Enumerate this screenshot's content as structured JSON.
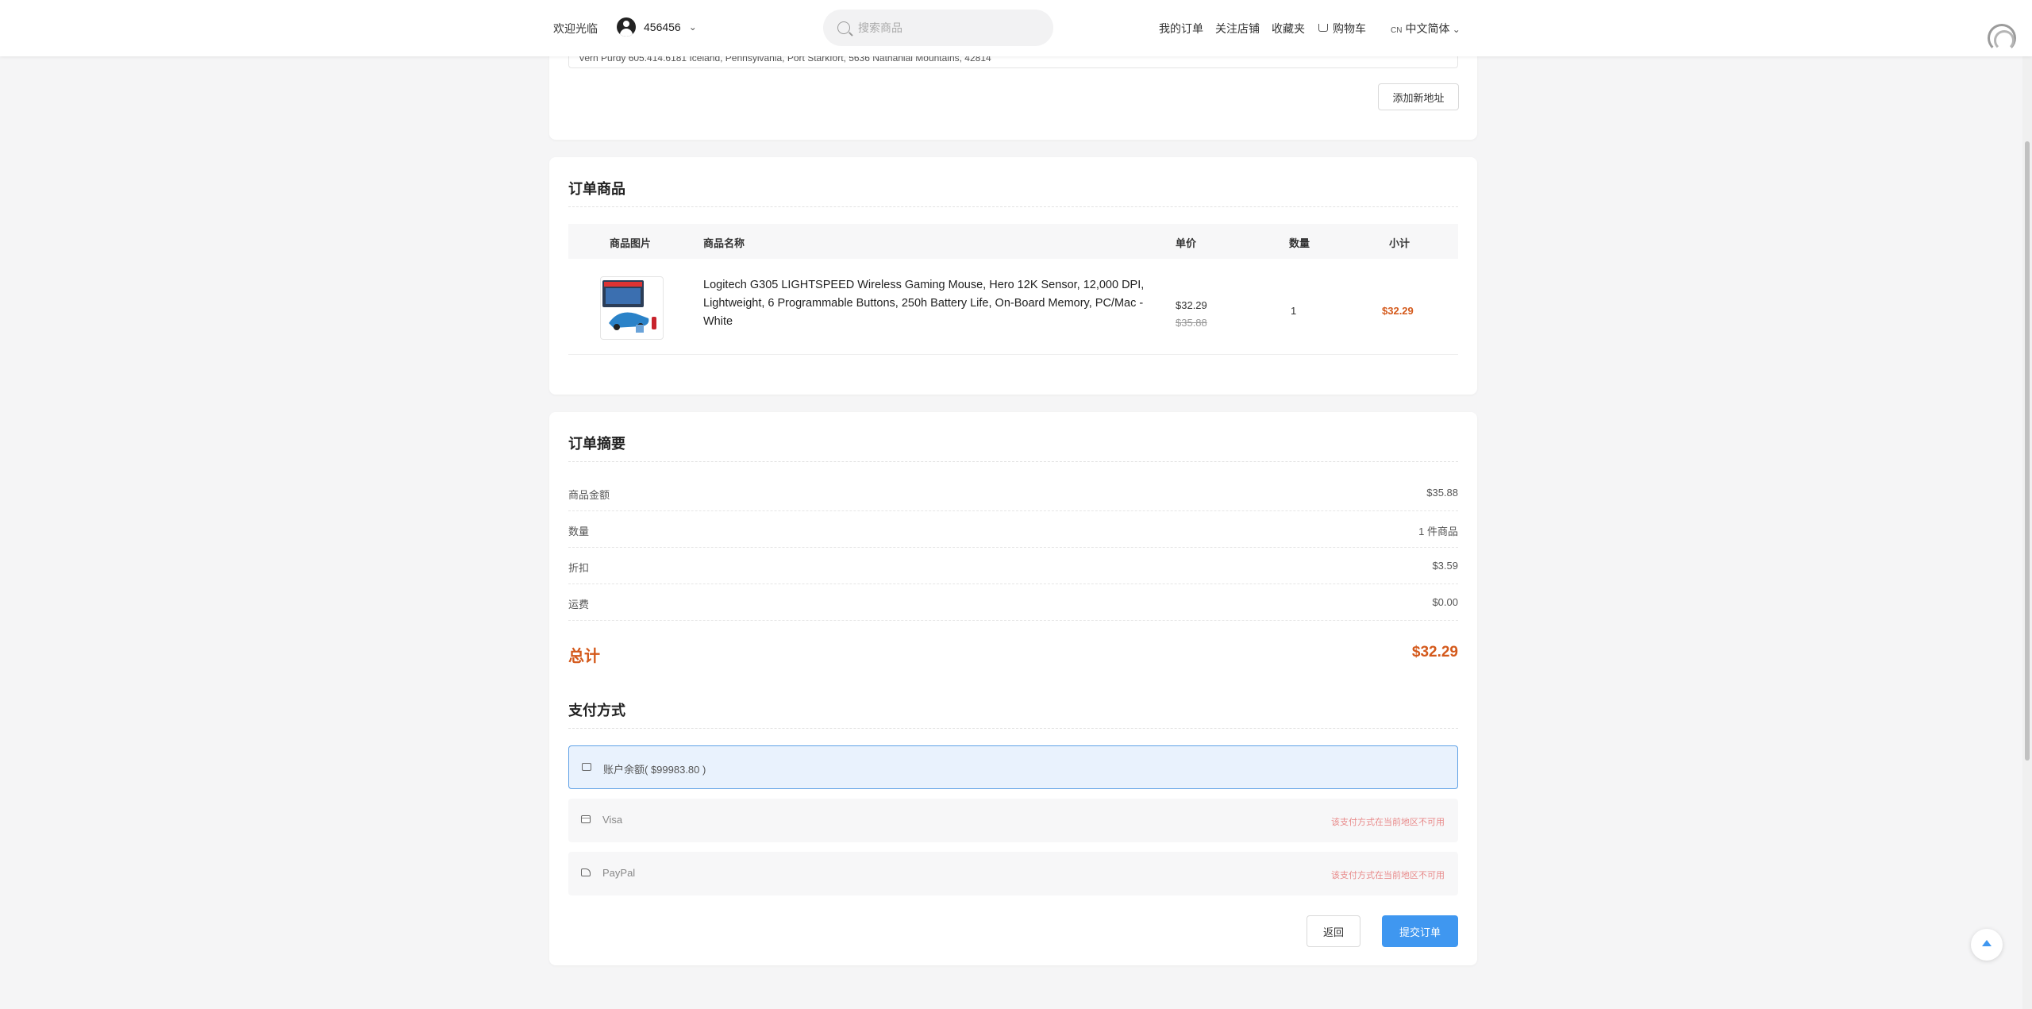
{
  "header": {
    "welcome": "欢迎光临",
    "username": "456456",
    "search_placeholder": "搜索商品",
    "nav": {
      "orders": "我的订单",
      "follow_store": "关注店铺",
      "favorites": "收藏夹",
      "cart": "购物车"
    },
    "lang_code": "CN",
    "lang_label": "中文简体"
  },
  "address": {
    "partial_line": "Vern Purdy   605.414.6181   Iceland, Pennsylvania, Port Starkfort, 5636 Nathanial Mountains, 42814",
    "add_button": "添加新地址"
  },
  "order_items": {
    "title": "订单商品",
    "columns": {
      "image": "商品图片",
      "name": "商品名称",
      "price": "单价",
      "qty": "数量",
      "subtotal": "小计"
    },
    "items": [
      {
        "name": "Logitech G305 LIGHTSPEED Wireless Gaming Mouse, Hero 12K Sensor, 12,000 DPI, Lightweight, 6 Programmable Buttons, 250h Battery Life, On-Board Memory, PC/Mac - White",
        "price": "$32.29",
        "original_price": "$35.88",
        "qty": "1",
        "subtotal": "$32.29"
      }
    ]
  },
  "summary": {
    "title": "订单摘要",
    "rows": [
      {
        "label": "商品金额",
        "value": "$35.88"
      },
      {
        "label": "数量",
        "value": "1 件商品"
      },
      {
        "label": "折扣",
        "value": "$3.59"
      },
      {
        "label": "运费",
        "value": "$0.00"
      }
    ],
    "total_label": "总计",
    "total_value": "$32.29"
  },
  "payment": {
    "title": "支付方式",
    "options": [
      {
        "label": "账户余额( $99983.80 )",
        "icon": "wallet-icon",
        "note": ""
      },
      {
        "label": "Visa",
        "icon": "credit-card-icon",
        "note": "该支付方式在当前地区不可用"
      },
      {
        "label": "PayPal",
        "icon": "paypal-icon",
        "note": "该支付方式在当前地区不可用"
      }
    ]
  },
  "actions": {
    "back": "返回",
    "submit": "提交订单"
  },
  "colors": {
    "accent": "#3f97f0",
    "price": "#d4591b",
    "warning": "#e88a8a"
  }
}
